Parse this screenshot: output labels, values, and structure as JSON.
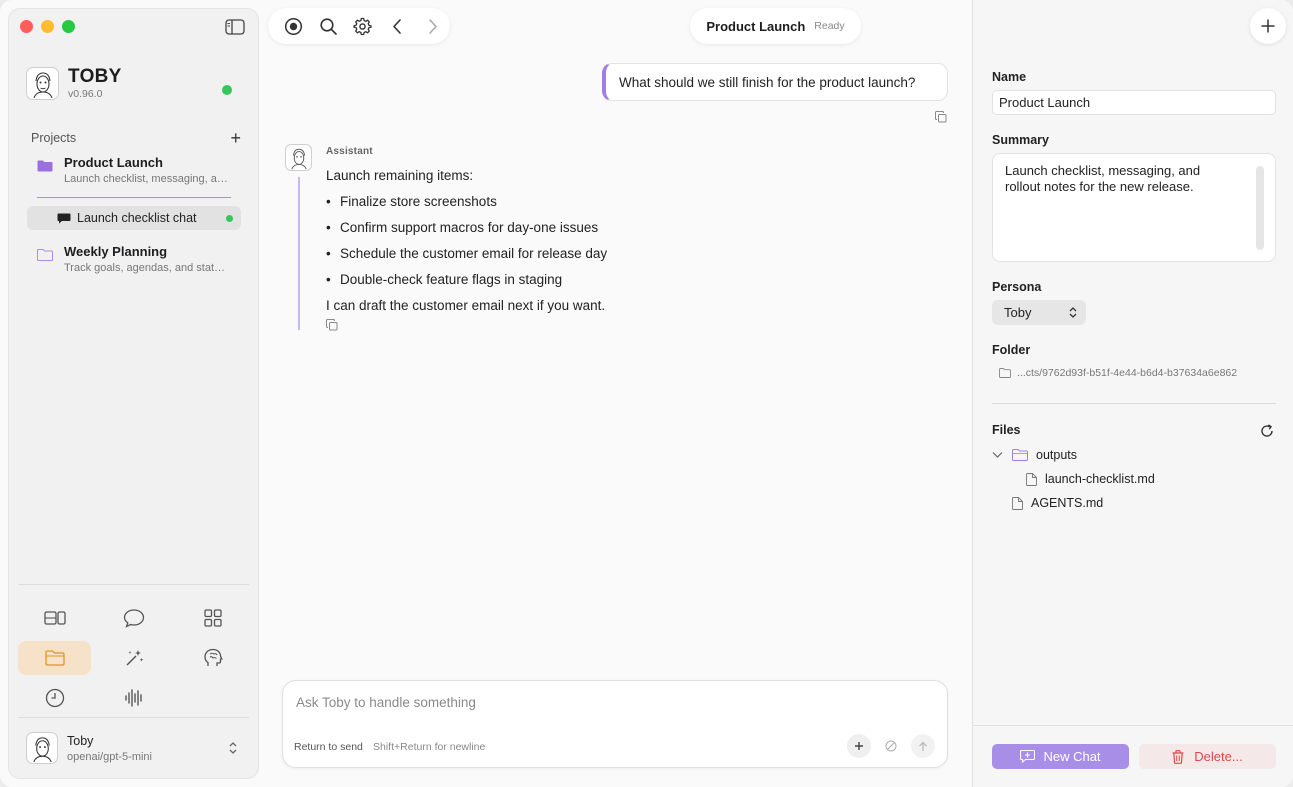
{
  "app": {
    "name": "TOBY",
    "version": "v0.96.0"
  },
  "sidebar": {
    "projects_title": "Projects",
    "projects": [
      {
        "title": "Product Launch",
        "subtitle": "Launch checklist, messaging, and rollout notes for the new release.",
        "folder_color": "#9b6fe0"
      },
      {
        "title": "Weekly Planning",
        "subtitle": "Track goals, agendas, and status updates.",
        "folder_color": "#b08be8"
      }
    ],
    "active_chat": "Launch checklist chat",
    "nav_icons": [
      "layout-icon",
      "chat-icon",
      "grid-icon",
      "folder-icon",
      "magic-wand-icon",
      "brain-icon",
      "clock-icon",
      "waveform-icon"
    ],
    "active_nav": "folder-icon",
    "user": {
      "name": "Toby",
      "model": "openai/gpt-5-mini"
    }
  },
  "header": {
    "title": "Product Launch",
    "status": "Ready"
  },
  "chat": {
    "user_message": "What should we still finish for the product launch?",
    "assistant": {
      "label": "Assistant",
      "intro": "Launch remaining items:",
      "items": [
        "Finalize store screenshots",
        "Confirm support macros for day-one issues",
        "Schedule the customer email for release day",
        "Double-check feature flags in staging"
      ],
      "outro": "I can draft the customer email next if you want."
    }
  },
  "composer": {
    "placeholder": "Ask Toby to handle something",
    "hint_send": "Return to send",
    "hint_newline": "Shift+Return for newline"
  },
  "details": {
    "name_label": "Name",
    "name_value": "Product Launch",
    "summary_label": "Summary",
    "summary_value": "Launch checklist, messaging, and rollout notes for the new release.",
    "persona_label": "Persona",
    "persona_value": "Toby",
    "folder_label": "Folder",
    "folder_path": "...cts/9762d93f-b51f-4e44-b6d4-b37634a6e862",
    "files_label": "Files",
    "files": {
      "folder": "outputs",
      "child": "launch-checklist.md",
      "root_file": "AGENTS.md"
    },
    "new_chat_label": "New Chat",
    "delete_label": "Delete..."
  },
  "colors": {
    "accent": "#a98ee8",
    "active_nav_bg": "#f6e2c8",
    "online": "#34c759",
    "danger": "#e04848"
  }
}
